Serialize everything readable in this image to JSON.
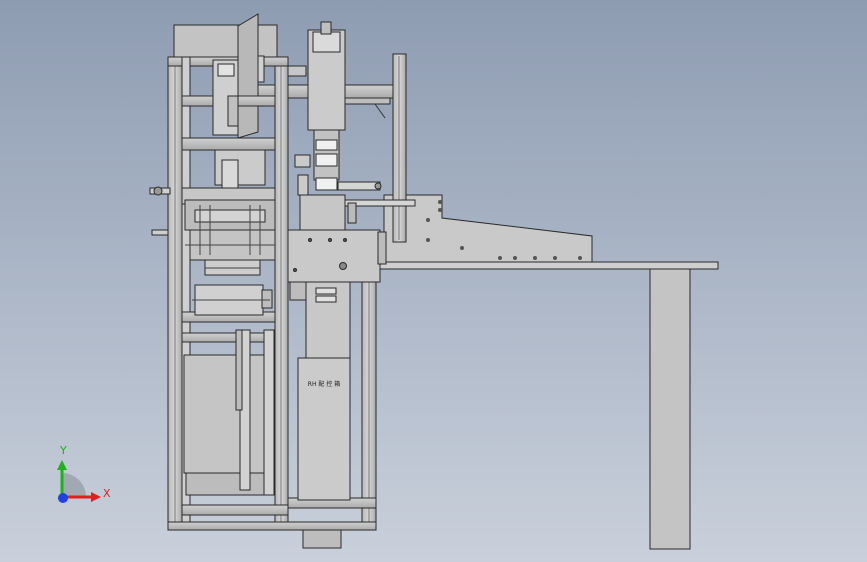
{
  "viewport": {
    "background_top": "#8e9cb2",
    "background_bottom": "#c9d0db"
  },
  "model": {
    "cabinet_label": "RH 配 控 箱",
    "line_color": "#2a2a2a",
    "steel_color": "#c8c8c8",
    "shadow_color": "#9a9a9a"
  },
  "triad": {
    "x_label": "X",
    "y_label": "Y",
    "x_color": "#e02020",
    "y_color": "#20b020",
    "z_color": "#2040e0"
  }
}
